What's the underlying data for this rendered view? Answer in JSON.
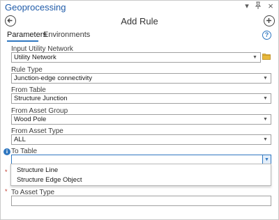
{
  "pane": {
    "title": "Geoprocessing",
    "menu_icon": "dropdown-menu-icon",
    "pin_icon": "pin-icon",
    "close_icon": "close-icon"
  },
  "tool": {
    "title": "Add Rule",
    "back_icon": "back-arrow-icon",
    "add_icon": "plus-icon"
  },
  "tabs": [
    {
      "label": "Parameters",
      "selected": true
    },
    {
      "label": "Environments",
      "selected": false
    }
  ],
  "help_icon": "help-icon",
  "params": {
    "input_utility_network": {
      "label": "Input Utility Network",
      "value": "Utility Network",
      "icon": "folder-icon"
    },
    "rule_type": {
      "label": "Rule Type",
      "value": "Junction-edge connectivity"
    },
    "from_table": {
      "label": "From Table",
      "value": "Structure Junction"
    },
    "from_asset_group": {
      "label": "From Asset Group",
      "value": "Wood Pole"
    },
    "from_asset_type": {
      "label": "From Asset Type",
      "value": "ALL"
    },
    "to_table": {
      "label": "To Table",
      "value": "",
      "info_icon": "info-icon",
      "options": [
        "Structure Line",
        "Structure Edge Object"
      ]
    },
    "to_asset_type": {
      "label": "To Asset Type",
      "value": ""
    }
  },
  "required_marker": "*",
  "colors": {
    "accent": "#2f77c0",
    "title": "#1e5aa8",
    "required": "#c0392b"
  }
}
